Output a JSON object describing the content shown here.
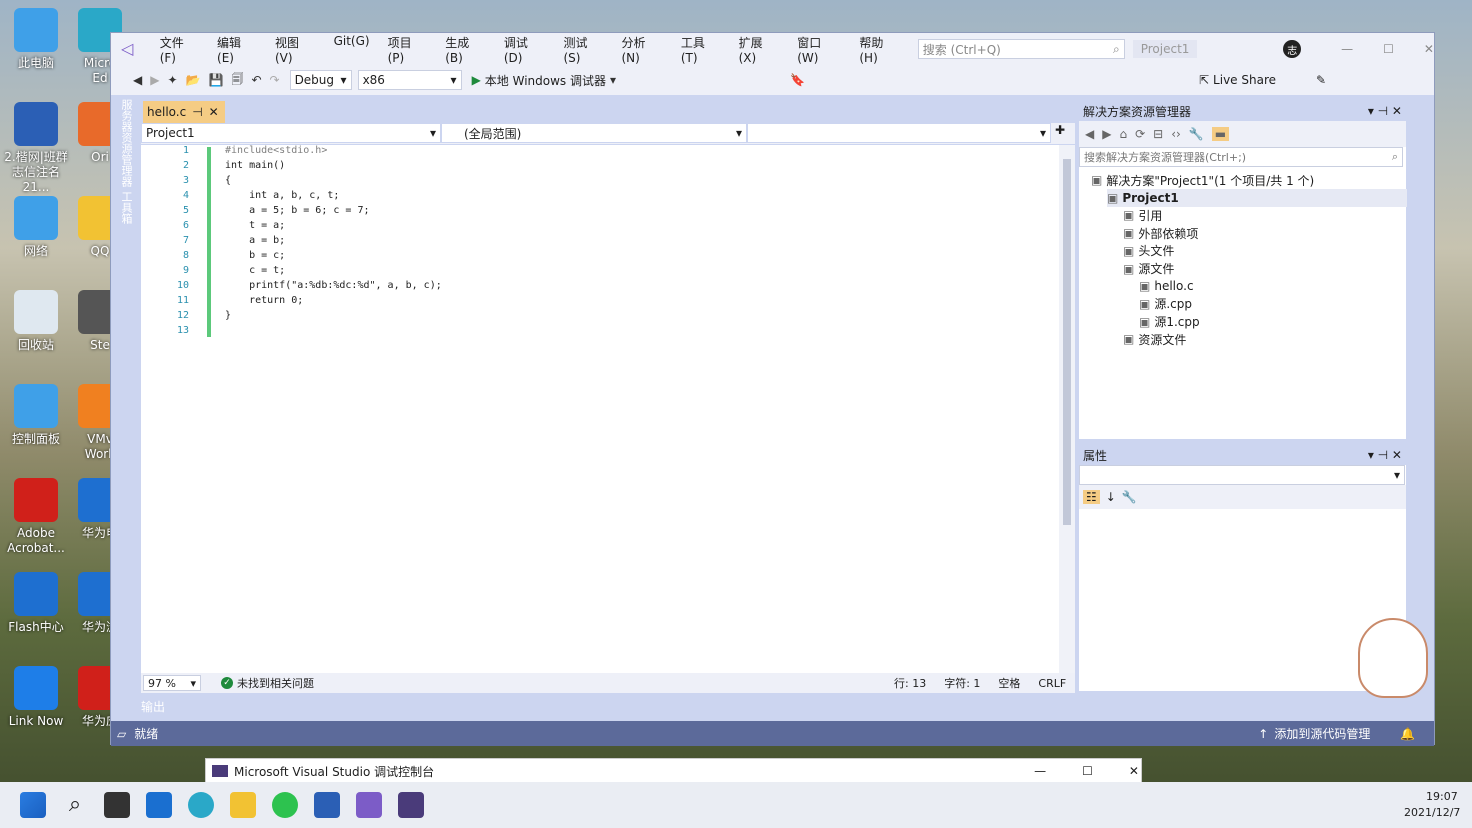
{
  "desktop_icons": [
    {
      "label": "此电脑",
      "icon": "computer-icon"
    },
    {
      "label": "Micro\nEd",
      "icon": "edge-icon"
    },
    {
      "label": "2.楷网|班群\n志信注名21...",
      "icon": "word-doc-icon"
    },
    {
      "label": "Ori",
      "icon": "app-icon"
    },
    {
      "label": "网络",
      "icon": "network-icon"
    },
    {
      "label": "QQ",
      "icon": "qq-icon"
    },
    {
      "label": "回收站",
      "icon": "recycle-bin-icon"
    },
    {
      "label": "Ste",
      "icon": "steam-icon"
    },
    {
      "label": "控制面板",
      "icon": "control-panel-icon"
    },
    {
      "label": "VMv\nWork",
      "icon": "vmware-icon"
    },
    {
      "label": "Adobe\nAcrobat...",
      "icon": "acrobat-icon"
    },
    {
      "label": "华为电",
      "icon": "huawei-icon"
    },
    {
      "label": "Flash中心",
      "icon": "flash-icon"
    },
    {
      "label": "华为浏",
      "icon": "huawei-browser-icon"
    },
    {
      "label": "Link Now",
      "icon": "linknow-icon"
    },
    {
      "label": "华为应",
      "icon": "huawei-appgallery-icon"
    }
  ],
  "menu": [
    "文件(F)",
    "编辑(E)",
    "视图(V)",
    "Git(G)",
    "项目(P)",
    "生成(B)",
    "调试(D)",
    "测试(S)",
    "分析(N)",
    "工具(T)",
    "扩展(X)",
    "窗口(W)",
    "帮助(H)"
  ],
  "search": {
    "placeholder": "搜索 (Ctrl+Q)"
  },
  "project_badge": "Project1",
  "user_avatar": "志",
  "toolbar": {
    "config": "Debug",
    "platform": "x86",
    "run_label": "本地 Windows 调试器",
    "live_share": "Live Share"
  },
  "side_tabs": [
    "服务器资源管理器",
    "工具箱"
  ],
  "editor": {
    "tab": "hello.c",
    "nav_project": "Project1",
    "nav_scope": "(全局范围)",
    "zoom": "97 %",
    "issues": "未找到相关问题",
    "line_info": "行: 13",
    "char_info": "字符: 1",
    "space_info": "空格",
    "eol": "CRLF",
    "lines": [
      {
        "n": "1",
        "t": "#include<stdio.h>"
      },
      {
        "n": "2",
        "t": "int main()"
      },
      {
        "n": "3",
        "t": "{"
      },
      {
        "n": "4",
        "t": "    int a, b, c, t;"
      },
      {
        "n": "5",
        "t": "    a = 5; b = 6; c = 7;"
      },
      {
        "n": "6",
        "t": "    t = a;"
      },
      {
        "n": "7",
        "t": "    a = b;"
      },
      {
        "n": "8",
        "t": "    b = c;"
      },
      {
        "n": "9",
        "t": "    c = t;"
      },
      {
        "n": "10",
        "t": "    printf(\"a:%db:%dc:%d\", a, b, c);"
      },
      {
        "n": "11",
        "t": "    return 0;"
      },
      {
        "n": "12",
        "t": "}"
      },
      {
        "n": "13",
        "t": ""
      }
    ]
  },
  "solution_explorer": {
    "title": "解决方案资源管理器",
    "search_placeholder": "搜索解决方案资源管理器(Ctrl+;)",
    "items": [
      {
        "label": "解决方案\"Project1\"(1 个项目/共 1 个)",
        "icon": "solution-icon",
        "bold": false
      },
      {
        "label": "Project1",
        "icon": "project-icon",
        "bold": true
      },
      {
        "label": "引用",
        "icon": "references-icon",
        "bold": false
      },
      {
        "label": "外部依赖项",
        "icon": "folder-icon",
        "bold": false
      },
      {
        "label": "头文件",
        "icon": "filter-icon",
        "bold": false
      },
      {
        "label": "源文件",
        "icon": "filter-icon",
        "bold": false
      },
      {
        "label": "hello.c",
        "icon": "c-file-icon",
        "bold": false
      },
      {
        "label": "源.cpp",
        "icon": "cpp-file-icon",
        "bold": false
      },
      {
        "label": "源1.cpp",
        "icon": "cpp-file-icon",
        "bold": false
      },
      {
        "label": "资源文件",
        "icon": "filter-icon",
        "bold": false
      }
    ]
  },
  "properties": {
    "title": "属性"
  },
  "output_label": "输出",
  "status": {
    "ready": "就绪",
    "source_control": "添加到源代码管理"
  },
  "console_title": "Microsoft Visual Studio 调试控制台",
  "clock": {
    "time": "19:07",
    "date": "2021/12/7"
  },
  "colors": {
    "accent": "#5c6a9a",
    "tab_active": "#f5cc84",
    "keyword": "#0000ff",
    "string": "#a31515",
    "preproc": "#808080"
  }
}
